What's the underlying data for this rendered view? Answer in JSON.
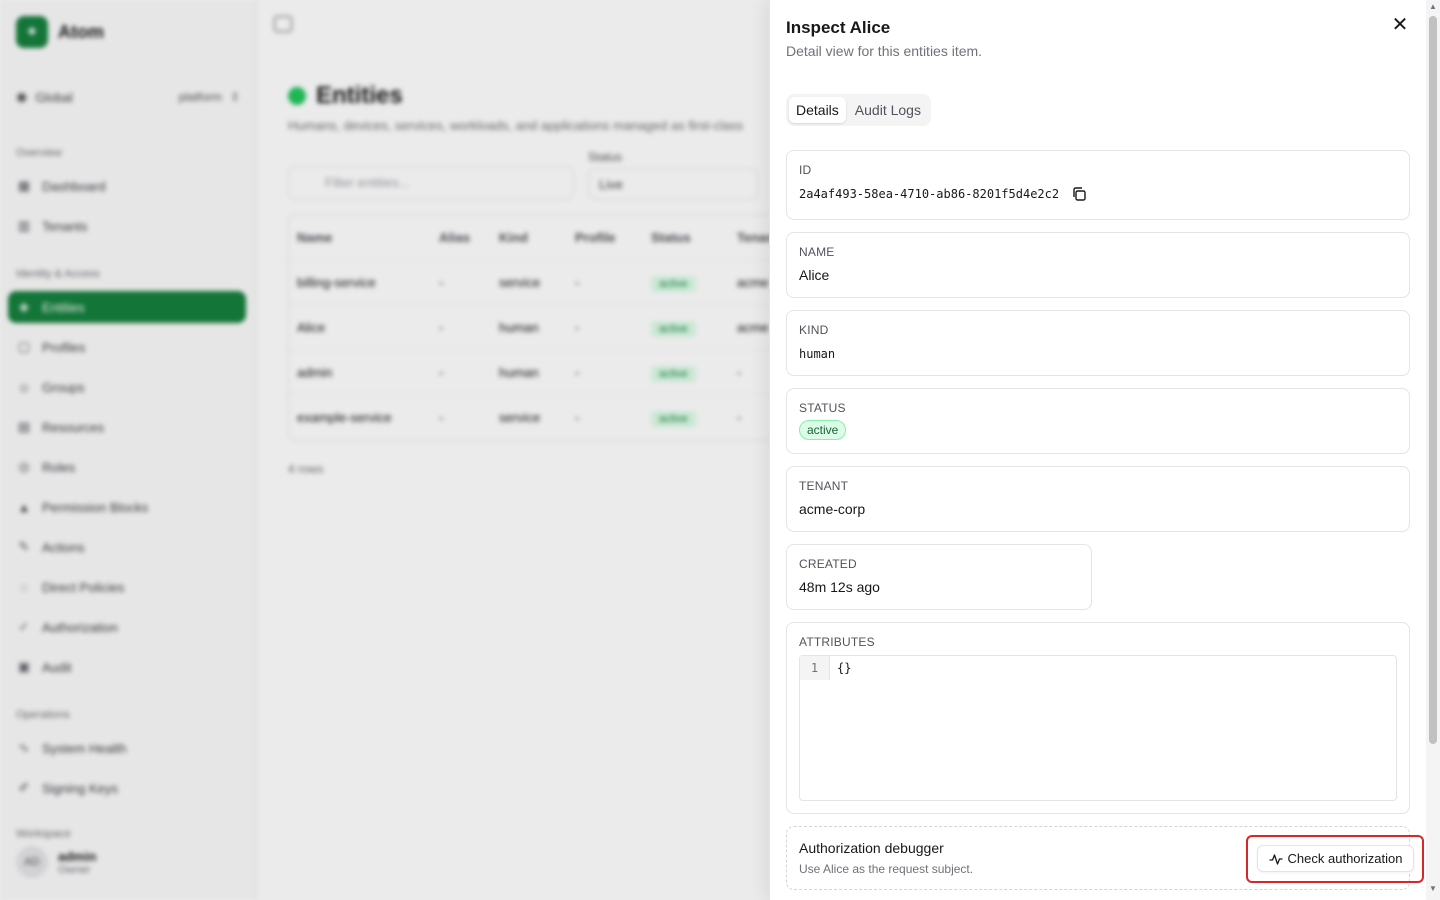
{
  "app": {
    "brand": "Atom",
    "scope_label": "Global",
    "scope_value": "platform",
    "sections": {
      "overview": "Overview",
      "identity": "Identity & Access",
      "operations": "Operations",
      "workspace": "Workspace"
    },
    "nav": [
      {
        "label": "Dashboard",
        "icon": "dashboard-icon"
      },
      {
        "label": "Tenants",
        "icon": "building-icon"
      },
      {
        "label": "Entities",
        "icon": "entity-icon"
      },
      {
        "label": "Profiles",
        "icon": "profile-icon"
      },
      {
        "label": "Groups",
        "icon": "group-icon"
      },
      {
        "label": "Resources",
        "icon": "resource-icon"
      },
      {
        "label": "Roles",
        "icon": "role-icon"
      },
      {
        "label": "Permission Blocks",
        "icon": "lock-icon"
      },
      {
        "label": "Actions",
        "icon": "action-icon"
      },
      {
        "label": "Direct Policies",
        "icon": "policy-icon"
      },
      {
        "label": "Authorization",
        "icon": "key-icon"
      },
      {
        "label": "Audit",
        "icon": "audit-icon"
      },
      {
        "label": "System Health",
        "icon": "health-icon"
      },
      {
        "label": "Signing Keys",
        "icon": "signing-key-icon"
      }
    ],
    "user": {
      "initials": "AD",
      "name": "admin",
      "role": "Owner"
    }
  },
  "page": {
    "title": "Entities",
    "subtitle": "Humans, devices, services, workloads, and applications managed as first-class",
    "filter_placeholder": "Filter entities...",
    "status_label": "Status",
    "status_value": "Live",
    "columns": [
      "Name",
      "Alias",
      "Kind",
      "Profile",
      "Status",
      "Tenant"
    ],
    "rows": [
      {
        "name": "billing-service",
        "alias": "-",
        "kind": "service",
        "profile": "-",
        "status": "active",
        "tenant": "acme"
      },
      {
        "name": "Alice",
        "alias": "-",
        "kind": "human",
        "profile": "-",
        "status": "active",
        "tenant": "acme"
      },
      {
        "name": "admin",
        "alias": "-",
        "kind": "human",
        "profile": "-",
        "status": "active",
        "tenant": "-"
      },
      {
        "name": "example-service",
        "alias": "-",
        "kind": "service",
        "profile": "-",
        "status": "active",
        "tenant": "-"
      }
    ],
    "count": "4 rows"
  },
  "drawer": {
    "title": "Inspect Alice",
    "subtitle": "Detail view for this entities item.",
    "close_icon": "close-icon",
    "tabs": [
      {
        "label": "Details",
        "active": true
      },
      {
        "label": "Audit Logs",
        "active": false
      }
    ],
    "fields": {
      "id": {
        "label": "ID",
        "value": "2a4af493-58ea-4710-ab86-8201f5d4e2c2"
      },
      "name": {
        "label": "NAME",
        "value": "Alice"
      },
      "kind": {
        "label": "KIND",
        "value": "human"
      },
      "status": {
        "label": "STATUS",
        "value": "active"
      },
      "tenant": {
        "label": "TENANT",
        "value": "acme-corp"
      },
      "created": {
        "label": "CREATED",
        "value": "48m 12s ago"
      },
      "attributes": {
        "label": "ATTRIBUTES",
        "line_number": "1",
        "code": "{}"
      }
    },
    "debugger": {
      "title": "Authorization debugger",
      "subtitle": "Use Alice as the request subject.",
      "button_label": "Check authorization",
      "button_icon": "activity-icon"
    }
  },
  "colors": {
    "accent": "#15803d",
    "status_bg": "#dcfce7",
    "status_text": "#166534",
    "focus": "#dc2626"
  }
}
